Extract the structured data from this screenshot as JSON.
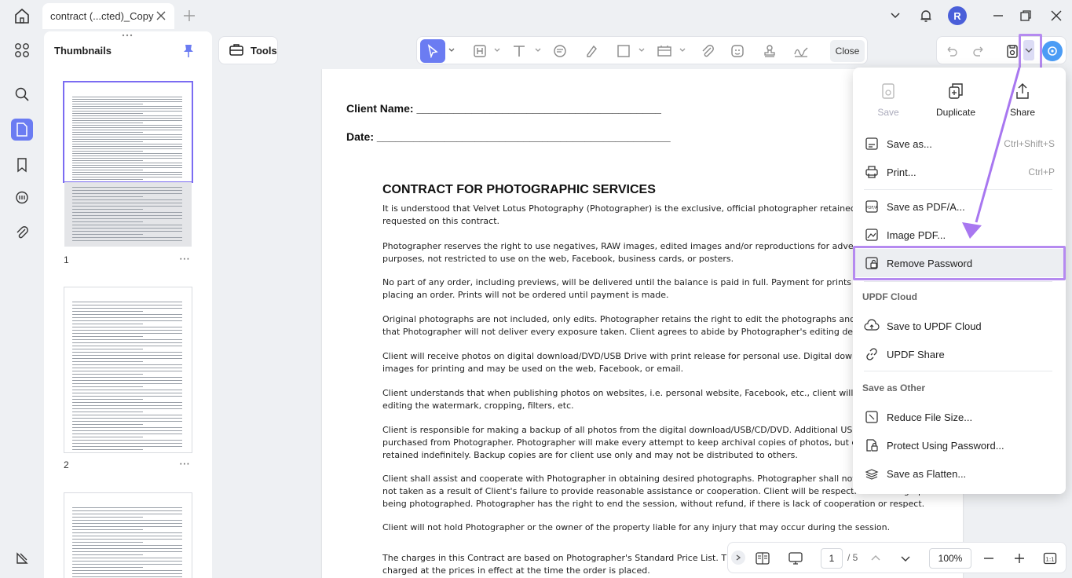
{
  "tab": {
    "title": "contract (...cted)_Copy"
  },
  "user": {
    "initial": "R"
  },
  "thumbnails": {
    "title": "Thumbnails",
    "pages": [
      "1",
      "2"
    ]
  },
  "toolbar": {
    "tools_label": "Tools",
    "close_label": "Close"
  },
  "document": {
    "client_name_label": "Client Name: ________________________________________",
    "date_label": "Date: ________________________________________________",
    "title": "CONTRACT FOR PHOTOGRAPHIC SERVICES",
    "paragraphs": [
      [
        "It is understood that Velvet Lotus Photography (Photographer) is the exclusive, official photographer retained to perform photogr",
        "requested on this contract."
      ],
      [
        "Photographer reserves the right to use negatives, RAW images, edited images and/or reproductions for advertising, display, public",
        "purposes, not restricted to use on the web, Facebook, business cards, or posters."
      ],
      [
        "No part of any order, including previews, will be delivered until the balance is paid in full. Payment for prints is required in full",
        "placing an order. Prints will not be ordered until payment is made."
      ],
      [
        "Original photographs are not included, only edits. Photographer retains the right to edit the photographs and omit any image. It",
        "that Photographer will not deliver every exposure taken. Client agrees to abide by Photographer's editing decisions."
      ],
      [
        "Client will receive photos on digital download/DVD/USB Drive with print release for personal use. Digital download/DVD/USB D",
        "images for printing and may be used on the web, Facebook, or email."
      ],
      [
        "Client understands that when publishing photos on websites, i.e. personal website, Facebook, etc., client will not edit the photos i",
        "editing the watermark, cropping, filters, etc."
      ],
      [
        "Client is responsible for making a backup of all photos from the digital download/USB/CD/DVD. Additional USB drives/CDs/D",
        "purchased from Photographer. Photographer will make every attempt to keep archival copies of photos, but does not guarantee th",
        "retained indefinitely. Backup copies are for client use only and may not be distributed to others."
      ],
      [
        "Client shall assist and cooperate with Photographer in obtaining desired photographs. Photographer shall not be responsible for",
        "not taken as a result of Client's failure to provide reasonable assistance or cooperation. Client will be respectful to Photographer a",
        "being photographed. Photographer has the right to end the session, without refund, if there is lack of cooperation or respect."
      ],
      [
        "Client will not hold Photographer or the owner of the property liable for any injury that may occur during the session."
      ],
      [
        "The charges in this Contract are based on Photographer's Standard Price List. This price list is",
        "charged at the prices in effect at the time the order is placed."
      ]
    ]
  },
  "pagination": {
    "current": "1",
    "total": "/ 5",
    "zoom": "100%"
  },
  "menu": {
    "top": [
      {
        "label": "Save",
        "icon": "save-icon",
        "disabled": true
      },
      {
        "label": "Duplicate",
        "icon": "duplicate-icon"
      },
      {
        "label": "Share",
        "icon": "share-icon"
      }
    ],
    "items": [
      {
        "label": "Save as...",
        "shortcut": "Ctrl+Shift+S"
      },
      {
        "label": "Print...",
        "shortcut": "Ctrl+P"
      },
      {
        "label": "Save as PDF/A..."
      },
      {
        "label": "Image PDF..."
      },
      {
        "label": "Remove Password"
      },
      {
        "label": "Save to UPDF Cloud"
      },
      {
        "label": "UPDF Share"
      },
      {
        "label": "Reduce File Size..."
      },
      {
        "label": "Protect Using Password..."
      },
      {
        "label": "Save as Flatten..."
      }
    ],
    "sections": {
      "cloud": "UPDF Cloud",
      "other": "Save as Other"
    }
  },
  "colors": {
    "accent": "#6b7cf2",
    "highlight": "#b58af0"
  }
}
